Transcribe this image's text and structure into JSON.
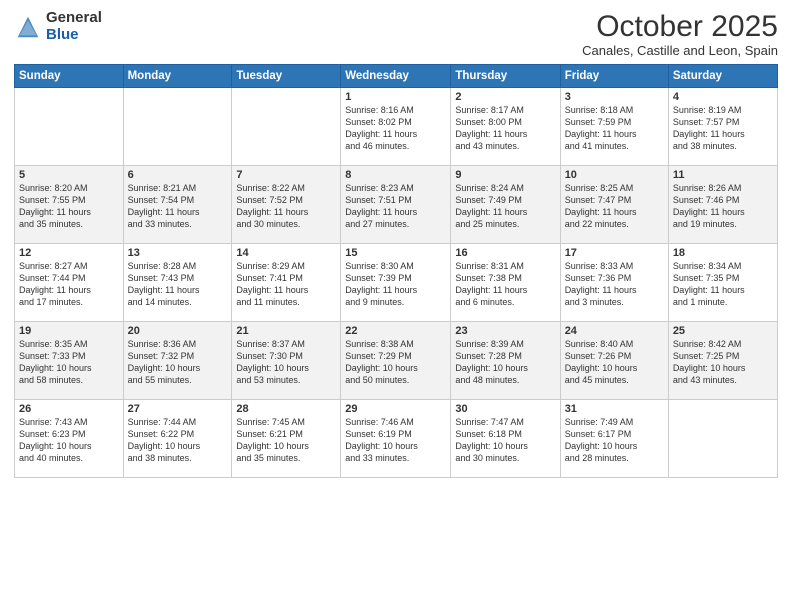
{
  "logo": {
    "general": "General",
    "blue": "Blue"
  },
  "header": {
    "month": "October 2025",
    "location": "Canales, Castille and Leon, Spain"
  },
  "days_of_week": [
    "Sunday",
    "Monday",
    "Tuesday",
    "Wednesday",
    "Thursday",
    "Friday",
    "Saturday"
  ],
  "weeks": [
    [
      {
        "day": "",
        "info": ""
      },
      {
        "day": "",
        "info": ""
      },
      {
        "day": "",
        "info": ""
      },
      {
        "day": "1",
        "info": "Sunrise: 8:16 AM\nSunset: 8:02 PM\nDaylight: 11 hours\nand 46 minutes."
      },
      {
        "day": "2",
        "info": "Sunrise: 8:17 AM\nSunset: 8:00 PM\nDaylight: 11 hours\nand 43 minutes."
      },
      {
        "day": "3",
        "info": "Sunrise: 8:18 AM\nSunset: 7:59 PM\nDaylight: 11 hours\nand 41 minutes."
      },
      {
        "day": "4",
        "info": "Sunrise: 8:19 AM\nSunset: 7:57 PM\nDaylight: 11 hours\nand 38 minutes."
      }
    ],
    [
      {
        "day": "5",
        "info": "Sunrise: 8:20 AM\nSunset: 7:55 PM\nDaylight: 11 hours\nand 35 minutes."
      },
      {
        "day": "6",
        "info": "Sunrise: 8:21 AM\nSunset: 7:54 PM\nDaylight: 11 hours\nand 33 minutes."
      },
      {
        "day": "7",
        "info": "Sunrise: 8:22 AM\nSunset: 7:52 PM\nDaylight: 11 hours\nand 30 minutes."
      },
      {
        "day": "8",
        "info": "Sunrise: 8:23 AM\nSunset: 7:51 PM\nDaylight: 11 hours\nand 27 minutes."
      },
      {
        "day": "9",
        "info": "Sunrise: 8:24 AM\nSunset: 7:49 PM\nDaylight: 11 hours\nand 25 minutes."
      },
      {
        "day": "10",
        "info": "Sunrise: 8:25 AM\nSunset: 7:47 PM\nDaylight: 11 hours\nand 22 minutes."
      },
      {
        "day": "11",
        "info": "Sunrise: 8:26 AM\nSunset: 7:46 PM\nDaylight: 11 hours\nand 19 minutes."
      }
    ],
    [
      {
        "day": "12",
        "info": "Sunrise: 8:27 AM\nSunset: 7:44 PM\nDaylight: 11 hours\nand 17 minutes."
      },
      {
        "day": "13",
        "info": "Sunrise: 8:28 AM\nSunset: 7:43 PM\nDaylight: 11 hours\nand 14 minutes."
      },
      {
        "day": "14",
        "info": "Sunrise: 8:29 AM\nSunset: 7:41 PM\nDaylight: 11 hours\nand 11 minutes."
      },
      {
        "day": "15",
        "info": "Sunrise: 8:30 AM\nSunset: 7:39 PM\nDaylight: 11 hours\nand 9 minutes."
      },
      {
        "day": "16",
        "info": "Sunrise: 8:31 AM\nSunset: 7:38 PM\nDaylight: 11 hours\nand 6 minutes."
      },
      {
        "day": "17",
        "info": "Sunrise: 8:33 AM\nSunset: 7:36 PM\nDaylight: 11 hours\nand 3 minutes."
      },
      {
        "day": "18",
        "info": "Sunrise: 8:34 AM\nSunset: 7:35 PM\nDaylight: 11 hours\nand 1 minute."
      }
    ],
    [
      {
        "day": "19",
        "info": "Sunrise: 8:35 AM\nSunset: 7:33 PM\nDaylight: 10 hours\nand 58 minutes."
      },
      {
        "day": "20",
        "info": "Sunrise: 8:36 AM\nSunset: 7:32 PM\nDaylight: 10 hours\nand 55 minutes."
      },
      {
        "day": "21",
        "info": "Sunrise: 8:37 AM\nSunset: 7:30 PM\nDaylight: 10 hours\nand 53 minutes."
      },
      {
        "day": "22",
        "info": "Sunrise: 8:38 AM\nSunset: 7:29 PM\nDaylight: 10 hours\nand 50 minutes."
      },
      {
        "day": "23",
        "info": "Sunrise: 8:39 AM\nSunset: 7:28 PM\nDaylight: 10 hours\nand 48 minutes."
      },
      {
        "day": "24",
        "info": "Sunrise: 8:40 AM\nSunset: 7:26 PM\nDaylight: 10 hours\nand 45 minutes."
      },
      {
        "day": "25",
        "info": "Sunrise: 8:42 AM\nSunset: 7:25 PM\nDaylight: 10 hours\nand 43 minutes."
      }
    ],
    [
      {
        "day": "26",
        "info": "Sunrise: 7:43 AM\nSunset: 6:23 PM\nDaylight: 10 hours\nand 40 minutes."
      },
      {
        "day": "27",
        "info": "Sunrise: 7:44 AM\nSunset: 6:22 PM\nDaylight: 10 hours\nand 38 minutes."
      },
      {
        "day": "28",
        "info": "Sunrise: 7:45 AM\nSunset: 6:21 PM\nDaylight: 10 hours\nand 35 minutes."
      },
      {
        "day": "29",
        "info": "Sunrise: 7:46 AM\nSunset: 6:19 PM\nDaylight: 10 hours\nand 33 minutes."
      },
      {
        "day": "30",
        "info": "Sunrise: 7:47 AM\nSunset: 6:18 PM\nDaylight: 10 hours\nand 30 minutes."
      },
      {
        "day": "31",
        "info": "Sunrise: 7:49 AM\nSunset: 6:17 PM\nDaylight: 10 hours\nand 28 minutes."
      },
      {
        "day": "",
        "info": ""
      }
    ]
  ]
}
